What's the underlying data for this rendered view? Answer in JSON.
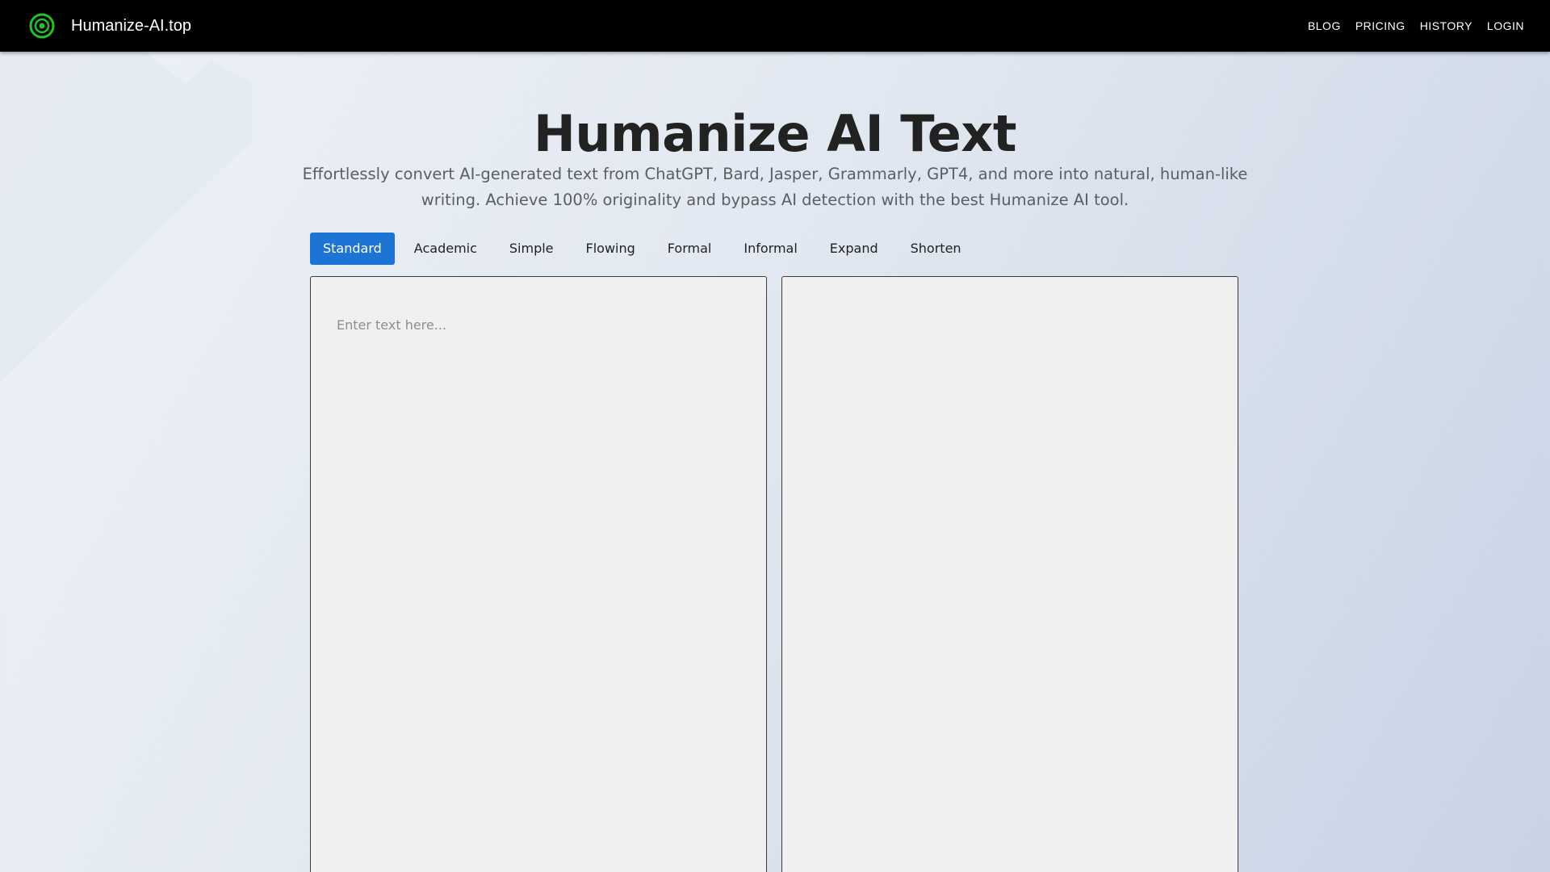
{
  "header": {
    "brand": "Humanize-AI.top",
    "logo_icon": "target-icon",
    "logo_color": "#22c322",
    "nav": [
      {
        "label": "BLOG"
      },
      {
        "label": "PRICING"
      },
      {
        "label": "HISTORY"
      },
      {
        "label": "LOGIN"
      }
    ]
  },
  "hero": {
    "title": "Humanize AI Text",
    "subtitle": "Effortlessly convert AI-generated text from ChatGPT, Bard, Jasper, Grammarly, GPT4, and more into natural, human-like writing. Achieve 100% originality and bypass AI detection with the best Humanize AI tool."
  },
  "modes": {
    "selected": "Standard",
    "accent_color": "#1d74d4",
    "items": [
      {
        "label": "Standard"
      },
      {
        "label": "Academic"
      },
      {
        "label": "Simple"
      },
      {
        "label": "Flowing"
      },
      {
        "label": "Formal"
      },
      {
        "label": "Informal"
      },
      {
        "label": "Expand"
      },
      {
        "label": "Shorten"
      }
    ]
  },
  "editor": {
    "input_placeholder": "Enter text here...",
    "input_value": "",
    "output_value": ""
  }
}
